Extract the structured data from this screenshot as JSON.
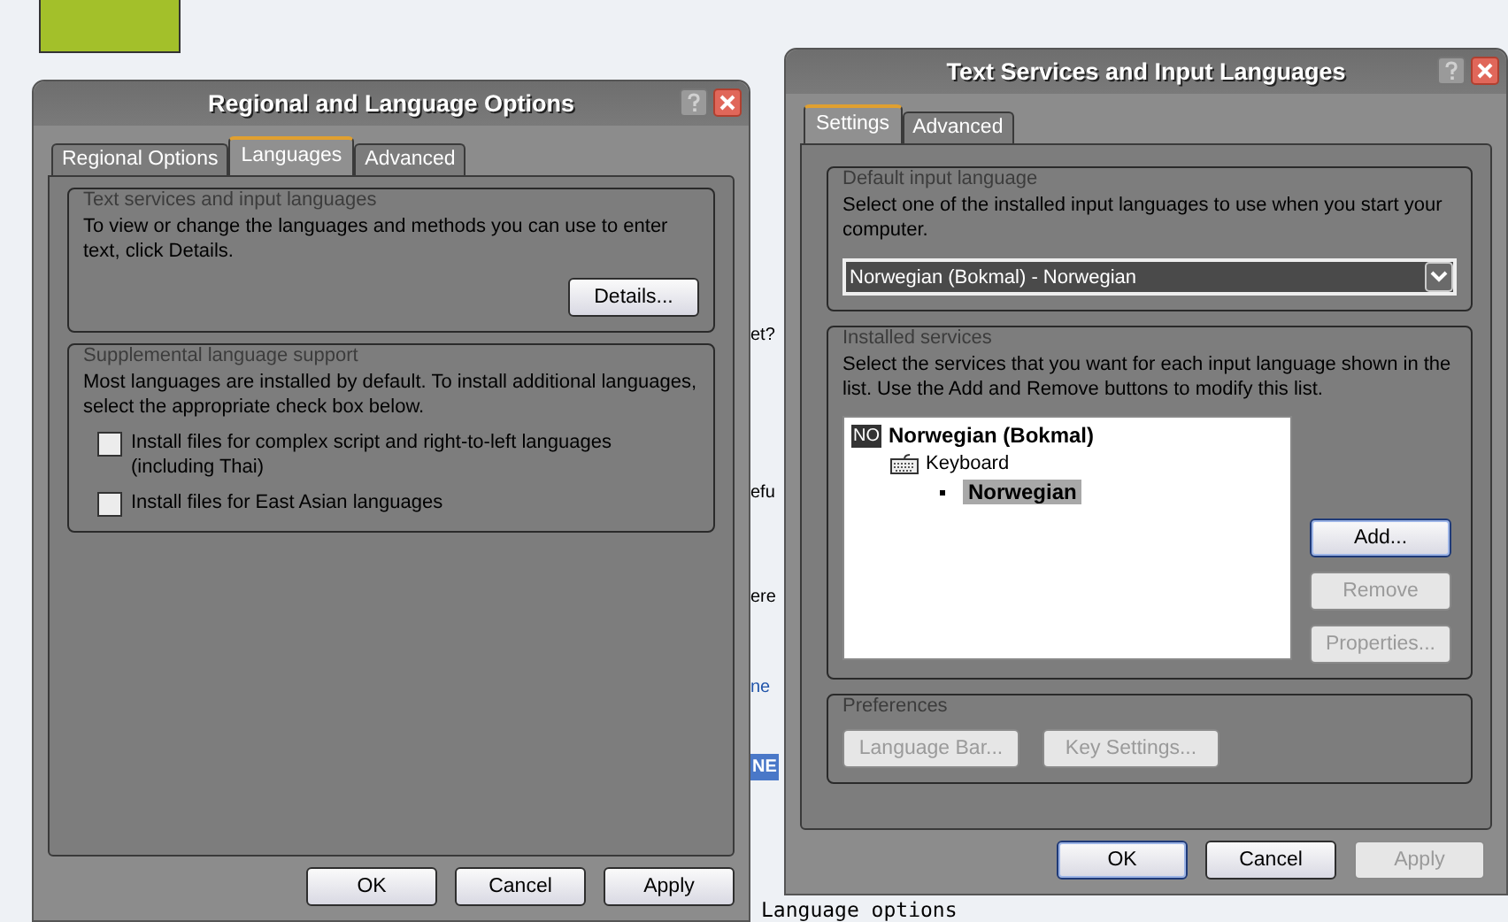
{
  "background_page": {
    "fragments": [
      {
        "text": "et?",
        "kind": "plain"
      },
      {
        "text": "efu",
        "kind": "plain"
      },
      {
        "text": "ere",
        "kind": "plain"
      },
      {
        "text": "ne",
        "kind": "link"
      },
      {
        "text": "NE",
        "kind": "badge"
      }
    ],
    "footer_text": "Language options"
  },
  "regional_dialog": {
    "title": "Regional and Language Options",
    "tabs": [
      {
        "label": "Regional Options",
        "selected": false
      },
      {
        "label": "Languages",
        "selected": true
      },
      {
        "label": "Advanced",
        "selected": false
      }
    ],
    "text_services": {
      "title": "Text services and input languages",
      "description": "To view or change the languages and methods you can use to enter text, click Details.",
      "button": {
        "label": "Details...",
        "disabled": false
      }
    },
    "supplemental": {
      "title": "Supplemental language support",
      "description": "Most languages are installed by default. To install additional languages, select the appropriate check box below.",
      "checkboxes": [
        {
          "label": "Install files for complex script and right-to-left languages (including Thai)",
          "checked": false
        },
        {
          "label": "Install files for East Asian languages",
          "checked": false
        }
      ]
    },
    "buttons": [
      {
        "label": "OK",
        "disabled": false
      },
      {
        "label": "Cancel",
        "disabled": false
      },
      {
        "label": "Apply",
        "disabled": false
      }
    ]
  },
  "text_services_dialog": {
    "title": "Text Services and Input Languages",
    "tabs": [
      {
        "label": "Settings",
        "selected": true
      },
      {
        "label": "Advanced",
        "selected": false
      }
    ],
    "default_input_language": {
      "title": "Default input language",
      "description": "Select one of the installed input languages to use when you start your computer.",
      "value": "Norwegian (Bokmal) - Norwegian"
    },
    "installed_services": {
      "title": "Installed services",
      "description": "Select the services that you want for each input language shown in the list. Use the Add and Remove buttons to modify this list.",
      "tree": [
        {
          "kind": "language",
          "badge": "NO",
          "label": "Norwegian (Bokmal)",
          "selected": false,
          "children": [
            {
              "kind": "category",
              "label": "Keyboard",
              "selected": false,
              "children": [
                {
                  "kind": "layout",
                  "label": "Norwegian",
                  "selected": true
                }
              ]
            }
          ]
        }
      ],
      "buttons": [
        {
          "label": "Add...",
          "disabled": false,
          "focused": true
        },
        {
          "label": "Remove",
          "disabled": true,
          "focused": false
        },
        {
          "label": "Properties...",
          "disabled": true,
          "focused": false
        }
      ]
    },
    "preferences": {
      "title": "Preferences",
      "buttons": [
        {
          "label": "Language Bar...",
          "disabled": true
        },
        {
          "label": "Key Settings...",
          "disabled": true
        }
      ]
    },
    "buttons": [
      {
        "label": "OK",
        "disabled": false,
        "focused": true
      },
      {
        "label": "Cancel",
        "disabled": false,
        "focused": false
      },
      {
        "label": "Apply",
        "disabled": true,
        "focused": false
      }
    ]
  }
}
